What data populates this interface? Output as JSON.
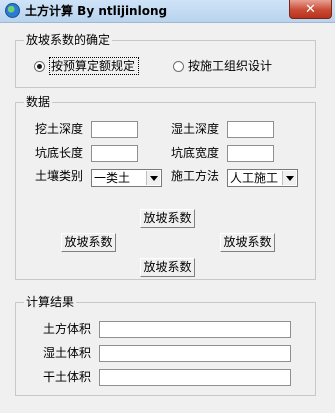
{
  "window": {
    "title": "土方计算 By ntlijinlong"
  },
  "slope_method": {
    "group_label": "放坡系数的确定",
    "option_budget": "按预算定额规定",
    "option_construction": "按施工组织设计",
    "selected": "option_budget"
  },
  "data_section": {
    "group_label": "数据",
    "dig_depth_label": "挖土深度",
    "dig_depth_value": "",
    "wet_depth_label": "湿土深度",
    "wet_depth_value": "",
    "pit_length_label": "坑底长度",
    "pit_length_value": "",
    "pit_width_label": "坑底宽度",
    "pit_width_value": "",
    "soil_type_label": "土壤类别",
    "soil_type_value": "一类土",
    "method_label": "施工方法",
    "method_value": "人工施工",
    "slope_top": "放坡系数",
    "slope_left": "放坡系数",
    "slope_right": "放坡系数",
    "slope_bottom": "放坡系数"
  },
  "results": {
    "group_label": "计算结果",
    "earth_volume_label": "土方体积",
    "earth_volume_value": "",
    "wet_volume_label": "湿土体积",
    "wet_volume_value": "",
    "dry_volume_label": "干土体积",
    "dry_volume_value": ""
  }
}
